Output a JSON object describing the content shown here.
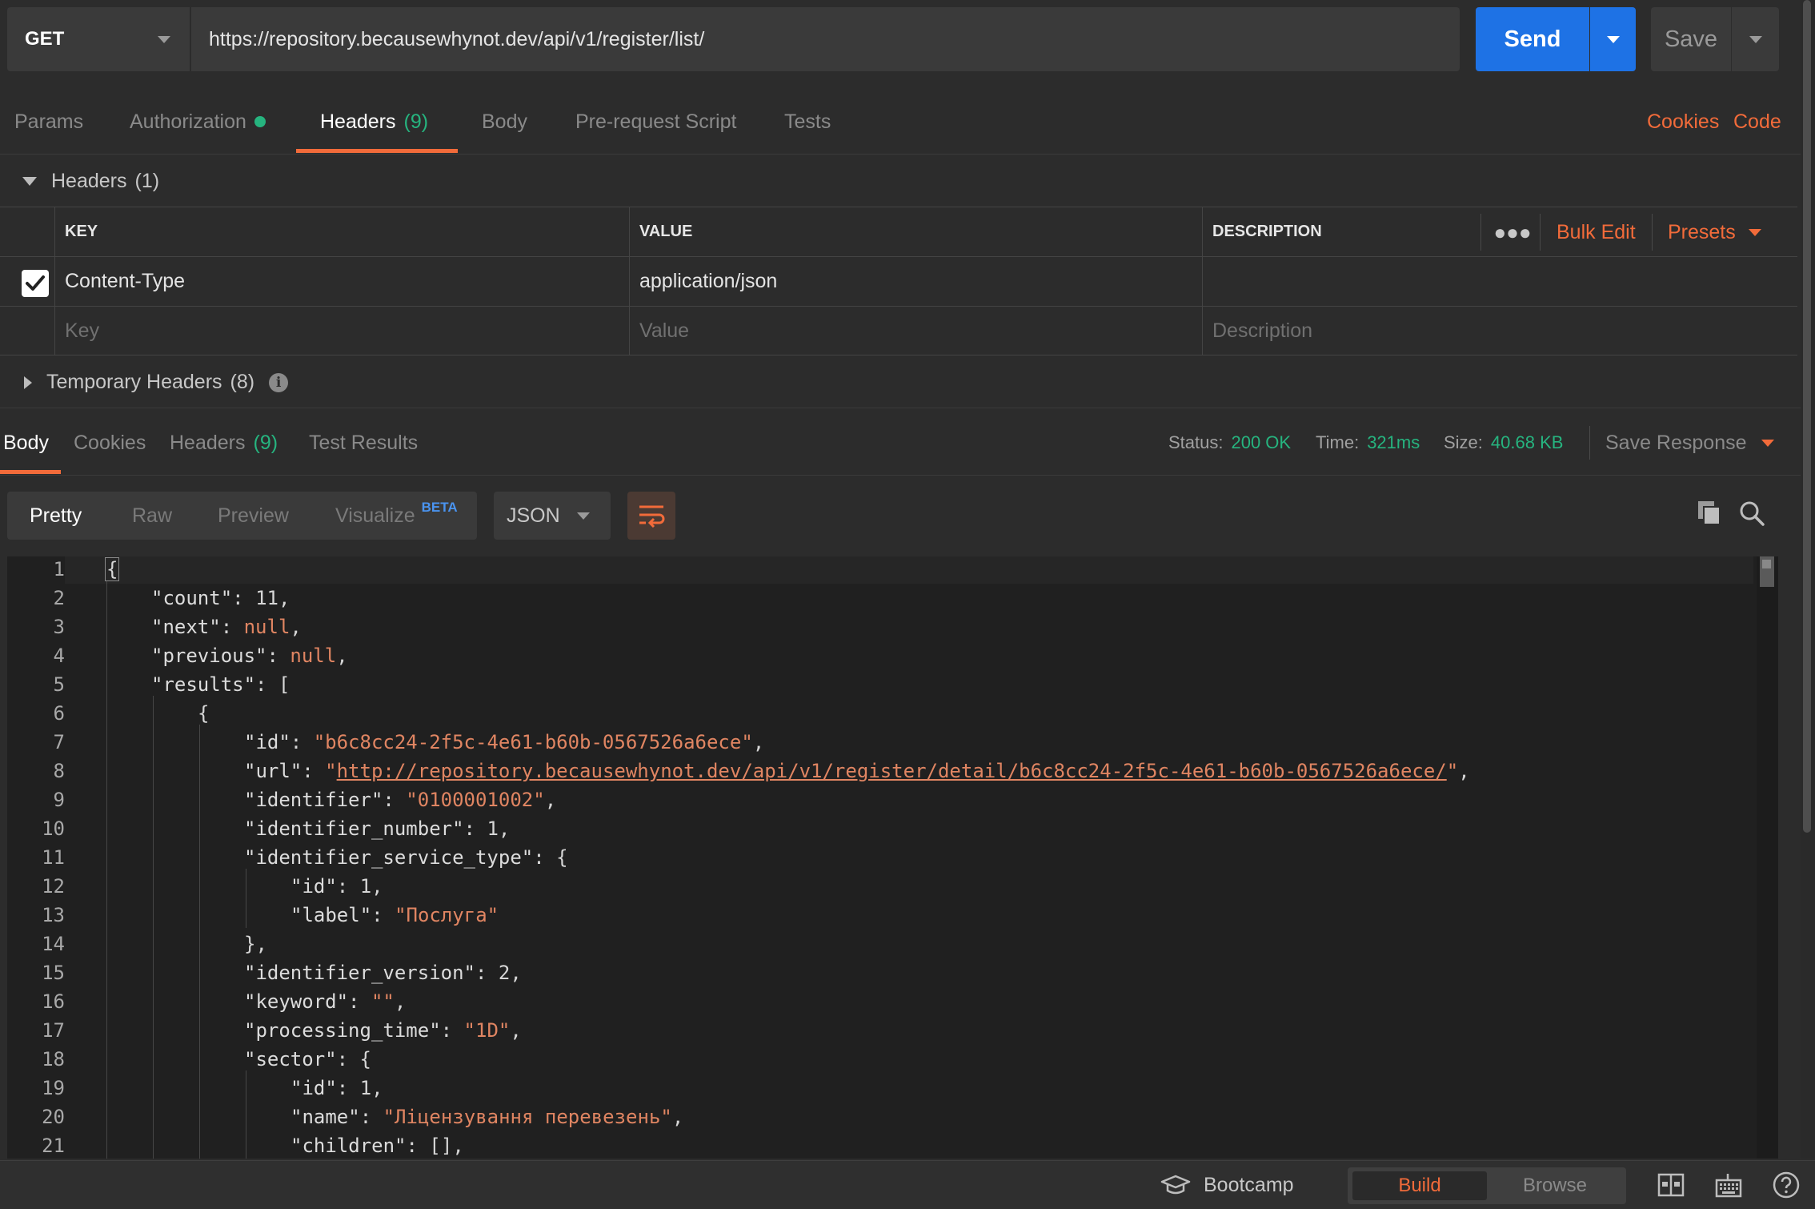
{
  "request": {
    "method": "GET",
    "url": "https://repository.becausewhynot.dev/api/v1/register/list/",
    "send_label": "Send",
    "save_label": "Save"
  },
  "request_tabs": {
    "params": "Params",
    "authorization": "Authorization",
    "headers": "Headers",
    "headers_count": "(9)",
    "body": "Body",
    "prerequest": "Pre-request Script",
    "tests": "Tests",
    "cookies": "Cookies",
    "code": "Code"
  },
  "headers_section": {
    "title": "Headers",
    "count": "(1)",
    "columns": {
      "key": "KEY",
      "value": "VALUE",
      "description": "DESCRIPTION"
    },
    "bulk_edit": "Bulk Edit",
    "presets": "Presets",
    "rows": [
      {
        "key": "Content-Type",
        "value": "application/json",
        "description": "",
        "checked": true
      }
    ],
    "placeholders": {
      "key": "Key",
      "value": "Value",
      "description": "Description"
    },
    "temporary": "Temporary Headers",
    "temporary_count": "(8)"
  },
  "response_tabs": {
    "body": "Body",
    "cookies": "Cookies",
    "headers": "Headers",
    "headers_count": "(9)",
    "test_results": "Test Results"
  },
  "response_stats": {
    "status_label": "Status:",
    "status": "200 OK",
    "time_label": "Time:",
    "time": "321ms",
    "size_label": "Size:",
    "size": "40.68 KB",
    "save_response": "Save Response"
  },
  "body_toolbar": {
    "pretty": "Pretty",
    "raw": "Raw",
    "preview": "Preview",
    "visualize": "Visualize",
    "beta": "BETA",
    "format": "JSON"
  },
  "code": {
    "line_numbers": [
      "1",
      "2",
      "3",
      "4",
      "5",
      "6",
      "7",
      "8",
      "9",
      "10",
      "11",
      "12",
      "13",
      "14",
      "15",
      "16",
      "17",
      "18",
      "19",
      "20",
      "21"
    ],
    "brace_open": "{",
    "count_key": "\"count\"",
    "count_val": "11",
    "next_key": "\"next\"",
    "next_val": "null",
    "previous_key": "\"previous\"",
    "previous_val": "null",
    "results_key": "\"results\"",
    "id_key": "\"id\"",
    "id_val": "\"b6c8cc24-2f5c-4e61-b60b-0567526a6ece\"",
    "url_key": "\"url\"",
    "url_val": "http://repository.becausewhynot.dev/api/v1/register/detail/b6c8cc24-2f5c-4e61-b60b-0567526a6ece/",
    "identifier_key": "\"identifier\"",
    "identifier_val": "\"0100001002\"",
    "identifier_number_key": "\"identifier_number\"",
    "identifier_number_val": "1",
    "identifier_service_type_key": "\"identifier_service_type\"",
    "ist_id_key": "\"id\"",
    "ist_id_val": "1",
    "ist_label_key": "\"label\"",
    "ist_label_val": "\"Послуга\"",
    "identifier_version_key": "\"identifier_version\"",
    "identifier_version_val": "2",
    "keyword_key": "\"keyword\"",
    "keyword_val": "\"\"",
    "processing_time_key": "\"processing_time\"",
    "processing_time_val": "\"1D\"",
    "sector_key": "\"sector\"",
    "sector_id_key": "\"id\"",
    "sector_id_val": "1",
    "sector_name_key": "\"name\"",
    "sector_name_val": "\"Ліцензування перевезень\"",
    "children_key": "\"children\"",
    "children_val": "[]"
  },
  "footer": {
    "bootcamp": "Bootcamp",
    "build": "Build",
    "browse": "Browse"
  },
  "colors": {
    "accent": "#f26b3a",
    "send_blue": "#1e72e5",
    "status_green": "#26b47f"
  }
}
